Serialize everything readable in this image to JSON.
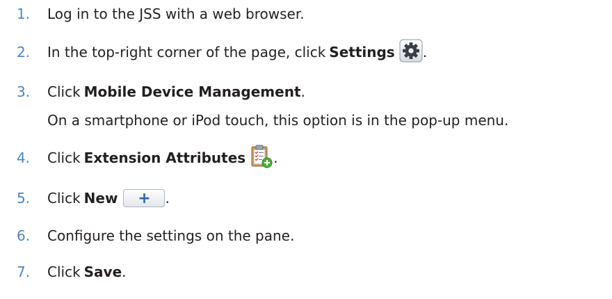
{
  "steps": [
    {
      "num": "1.",
      "text": "Log in to the JSS with a web browser."
    },
    {
      "num": "2.",
      "pre": "In the top-right corner of the page, click",
      "bold": "Settings",
      "post": ".",
      "icon": "gear-icon"
    },
    {
      "num": "3.",
      "pre": "Click",
      "bold": "Mobile Device Management",
      "post": ".",
      "sub": "On a smartphone or iPod touch, this option is in the pop-up menu."
    },
    {
      "num": "4.",
      "pre": "Click",
      "bold": "Extension Attributes",
      "post": ".",
      "icon": "clipboard-add-icon"
    },
    {
      "num": "5.",
      "pre": "Click",
      "bold": "New",
      "post": ".",
      "icon": "plus-icon",
      "button_glyph": "+"
    },
    {
      "num": "6.",
      "text": "Configure the settings on the pane."
    },
    {
      "num": "7.",
      "pre": "Click",
      "bold": "Save",
      "post": "."
    }
  ]
}
